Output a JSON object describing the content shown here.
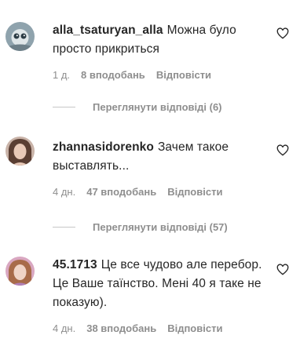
{
  "comments": [
    {
      "username": "alla_tsaturyan_alla",
      "text": "Можна було просто прикриться",
      "time": "1 д.",
      "likes": "8 вподобань",
      "reply_label": "Відповісти",
      "view_replies": "Переглянути відповіді (6)"
    },
    {
      "username": "zhannasidorenko",
      "text": "Зачем такое выставлять...",
      "time": "4 дн.",
      "likes": "47 вподобань",
      "reply_label": "Відповісти",
      "view_replies": "Переглянути відповіді (57)"
    },
    {
      "username": "45.1713",
      "text": "Це все чудово але перебор. Це Ваше таїнство. Мені 40 я таке не показую).",
      "time": "4 дн.",
      "likes": "38 вподобань",
      "reply_label": "Відповісти"
    }
  ],
  "colors": {
    "text": "#262626",
    "secondary": "#8e8e8e",
    "divider": "#c7c7c7"
  },
  "icons": [
    "avatar",
    "heart-icon"
  ]
}
